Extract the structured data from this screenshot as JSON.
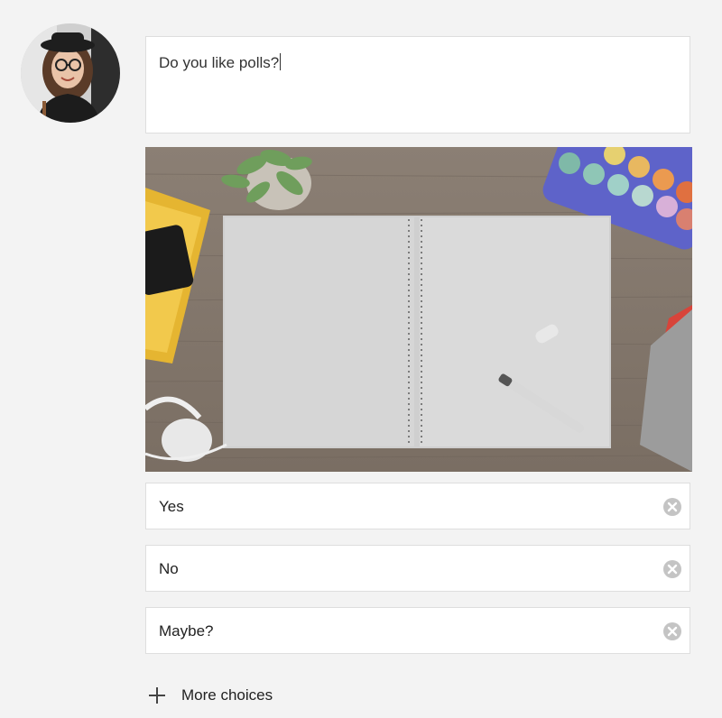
{
  "poll": {
    "question": "Do you like polls?",
    "choices": [
      {
        "label": "Yes"
      },
      {
        "label": "No"
      },
      {
        "label": "Maybe?"
      }
    ],
    "more_choices_label": "More choices"
  },
  "icons": {
    "remove": "close-circle-icon",
    "add": "plus-icon"
  },
  "colors": {
    "background": "#f3f3f3",
    "card": "#ffffff",
    "border": "#dedede",
    "icon_gray": "#c4c4c4"
  }
}
